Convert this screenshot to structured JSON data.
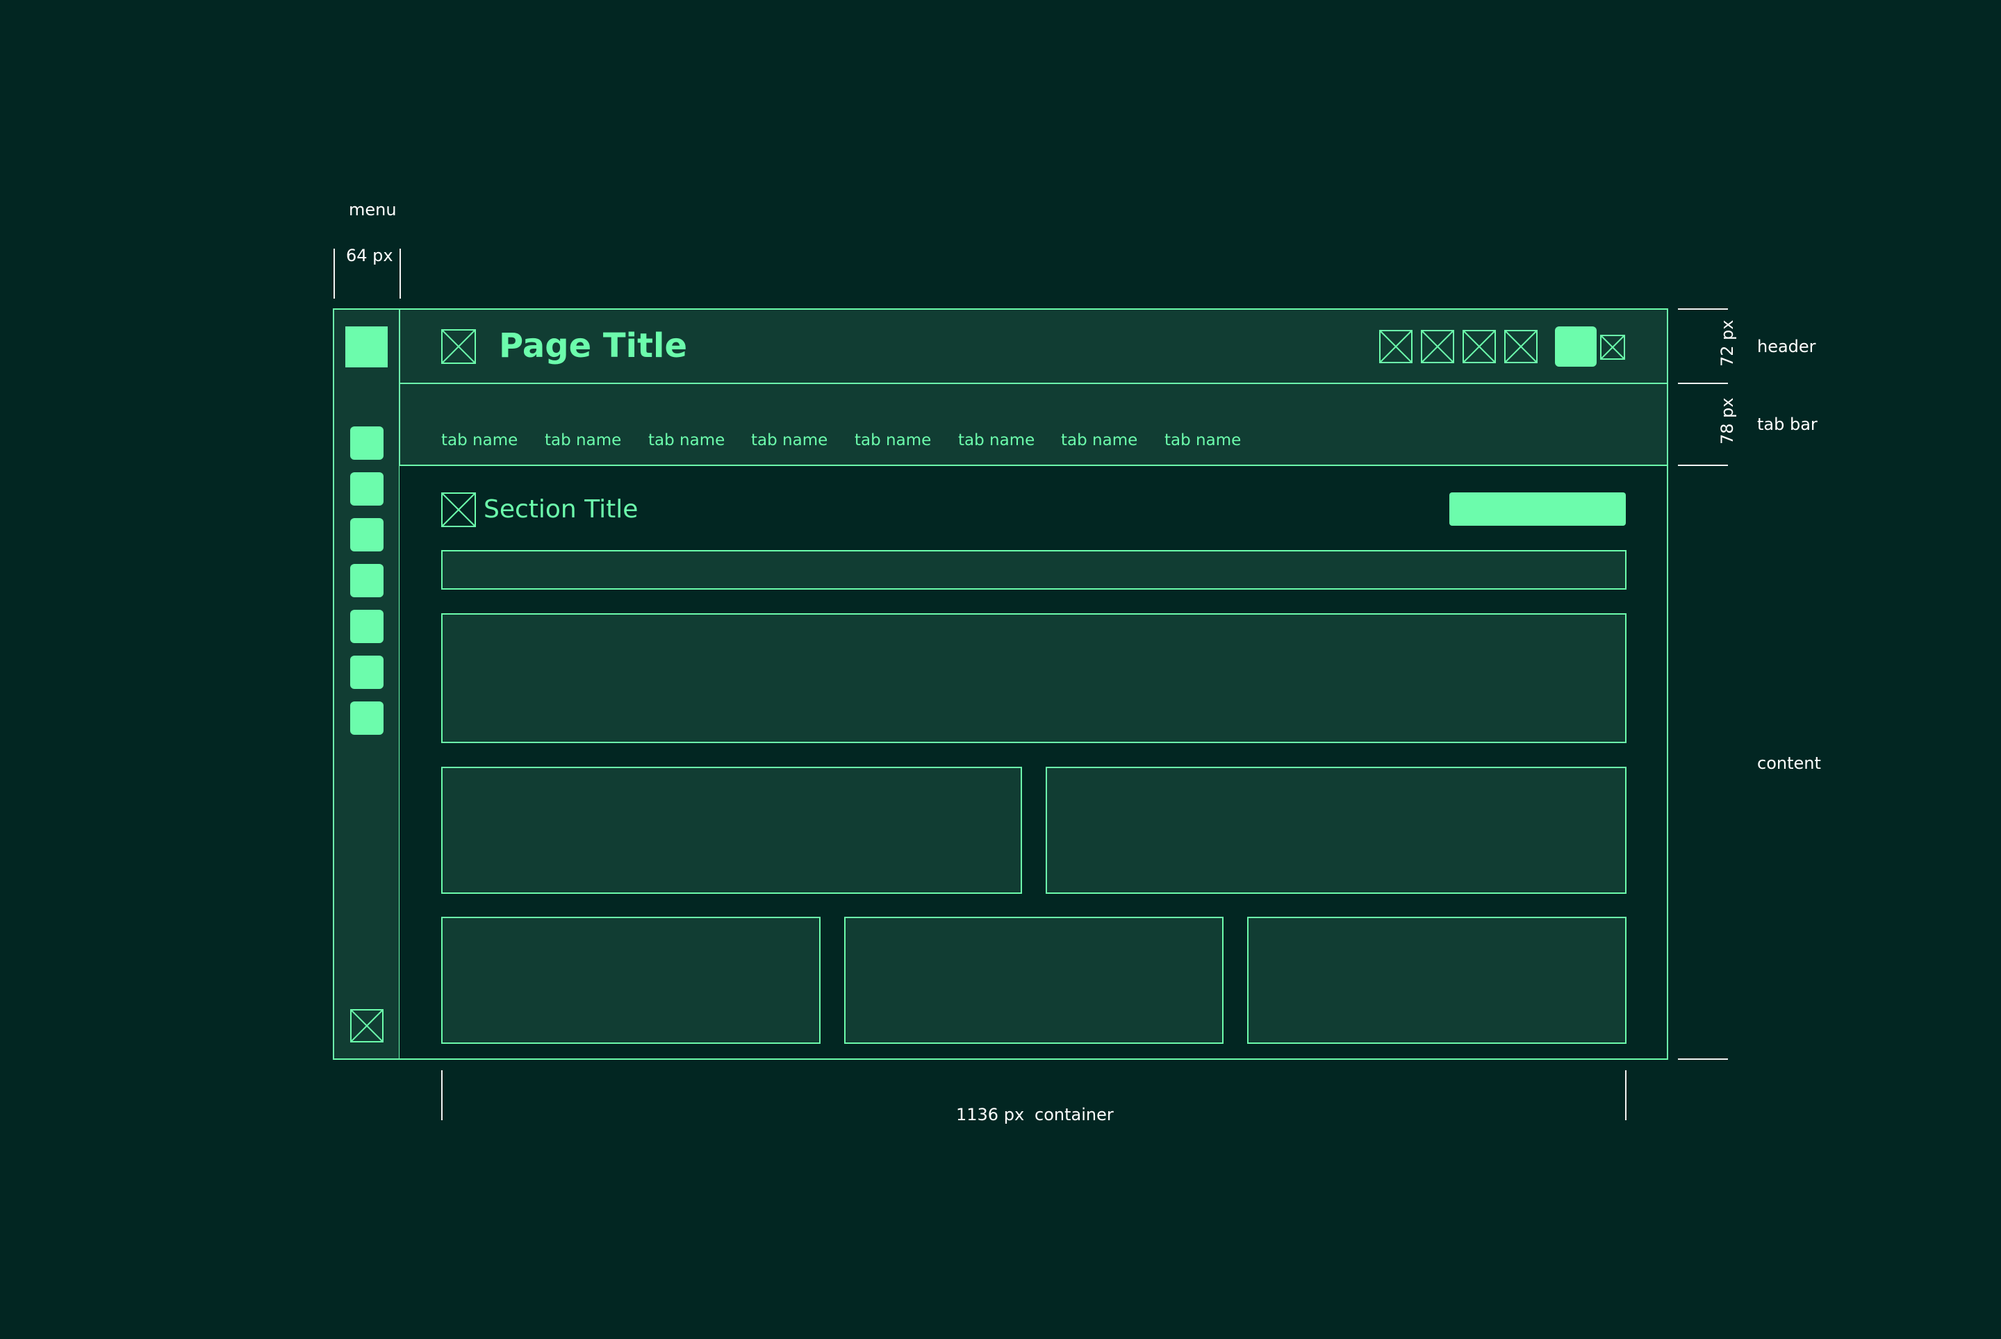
{
  "annotations": {
    "menu_label": "menu",
    "menu_width": "64 px",
    "header_label": "header",
    "header_height": "72 px",
    "tabbar_label": "tab bar",
    "tabbar_height": "78 px",
    "content_label": "content",
    "container_width": "1136 px",
    "container_label": "container"
  },
  "header": {
    "title": "Page Title"
  },
  "tabs": [
    {
      "label": "tab name"
    },
    {
      "label": "tab name"
    },
    {
      "label": "tab name"
    },
    {
      "label": "tab name"
    },
    {
      "label": "tab name"
    },
    {
      "label": "tab name"
    },
    {
      "label": "tab name"
    },
    {
      "label": "tab name"
    }
  ],
  "section": {
    "title": "Section Title"
  },
  "colors": {
    "background": "#022622",
    "panel": "#113d33",
    "accent": "#6cfcac",
    "annotation": "#ffffff"
  },
  "icons": {
    "placeholder": "image-placeholder-icon",
    "menu_item": "menu-item-icon"
  }
}
